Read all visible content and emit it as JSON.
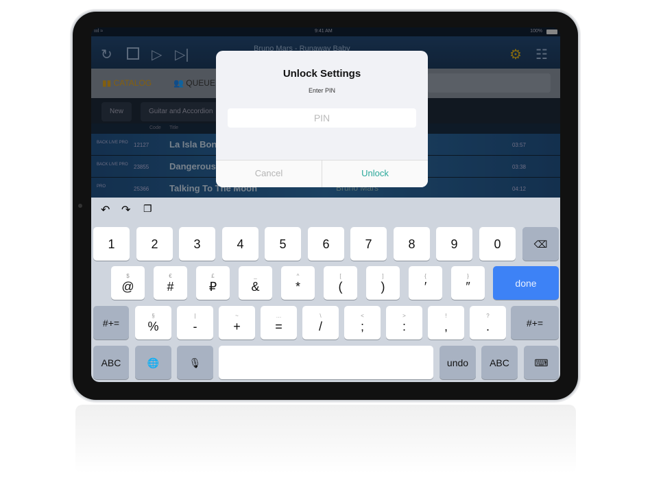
{
  "status": {
    "time": "9:41 AM",
    "battery": "100%"
  },
  "toolbar": {
    "now_playing": "Bruno Mars - Runaway Baby"
  },
  "tabs": [
    {
      "label": "CATALOG",
      "color": "#e0a41a"
    },
    {
      "label": "QUEUE"
    }
  ],
  "filter": {
    "chips": [
      "New",
      "Guitar and Accordion"
    ]
  },
  "table": {
    "headers": [
      "Code",
      "Title"
    ],
    "rows": [
      {
        "code": "12127",
        "title": "La Isla Bonita",
        "artist": "",
        "duration": "03:57",
        "badges": [
          "BACK",
          "LIVE",
          "PRO"
        ]
      },
      {
        "code": "23855",
        "title": "Dangerous",
        "artist": "",
        "duration": "03:38",
        "badges": [
          "BACK",
          "LIVE",
          "PRO"
        ]
      },
      {
        "code": "25366",
        "title": "Talking To The Moon",
        "artist": "Bruno Mars",
        "duration": "04:12",
        "badges": [
          "PRO"
        ]
      }
    ]
  },
  "dialog": {
    "title": "Unlock Settings",
    "subtitle": "Enter PIN",
    "placeholder": "PIN",
    "cancel": "Cancel",
    "unlock": "Unlock",
    "accent": "#2aa89a"
  },
  "keyboard": {
    "rows": [
      [
        {
          "m": "1"
        },
        {
          "m": "2"
        },
        {
          "m": "3"
        },
        {
          "m": "4"
        },
        {
          "m": "5"
        },
        {
          "m": "6"
        },
        {
          "m": "7"
        },
        {
          "m": "8"
        },
        {
          "m": "9"
        },
        {
          "m": "0"
        },
        {
          "m": "⌫",
          "type": "dark",
          "name": "backspace"
        }
      ],
      [
        {
          "a": "$",
          "m": "@"
        },
        {
          "a": "€",
          "m": "#"
        },
        {
          "a": "£",
          "m": "₽"
        },
        {
          "a": "_",
          "m": "&"
        },
        {
          "a": "^",
          "m": "*"
        },
        {
          "a": "[",
          "m": "("
        },
        {
          "a": "]",
          "m": ")"
        },
        {
          "a": "{",
          "m": "′"
        },
        {
          "a": "}",
          "m": "″"
        },
        {
          "m": "done",
          "type": "blue",
          "name": "done"
        }
      ],
      [
        {
          "m": "#+=",
          "type": "dark",
          "name": "shift"
        },
        {
          "a": "§",
          "m": "%"
        },
        {
          "a": "|",
          "m": "-"
        },
        {
          "a": "~",
          "m": "+"
        },
        {
          "a": "…",
          "m": "="
        },
        {
          "a": "\\",
          "m": "/"
        },
        {
          "a": "<",
          "m": ";"
        },
        {
          "a": ">",
          "m": ":"
        },
        {
          "a": "!",
          "m": ","
        },
        {
          "a": "?",
          "m": "."
        },
        {
          "m": "#+=",
          "type": "dark",
          "name": "shift"
        }
      ],
      [
        {
          "m": "ABC",
          "type": "dark",
          "name": "abc"
        },
        {
          "m": "🌐",
          "type": "dark",
          "name": "globe"
        },
        {
          "m": "🎙",
          "type": "dark",
          "name": "microphone"
        },
        {
          "m": "",
          "name": "space"
        },
        {
          "m": "undo",
          "type": "dark",
          "name": "undo"
        },
        {
          "m": "ABC",
          "type": "dark",
          "name": "abc"
        },
        {
          "m": "⌨",
          "type": "dark",
          "name": "hide-keyboard"
        }
      ]
    ],
    "done_color": "#3d82f6"
  }
}
